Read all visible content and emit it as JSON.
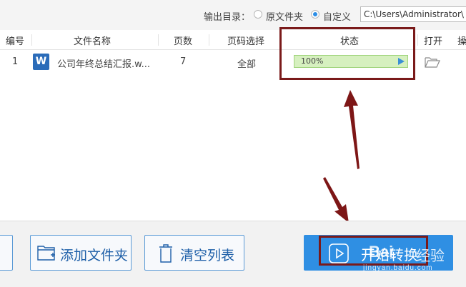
{
  "toolbar": {
    "output_label": "输出目录：",
    "radio_original": "原文件夹",
    "radio_custom": "自定义",
    "custom_selected": true,
    "path_value": "C:\\Users\\Administrator\\"
  },
  "table": {
    "headers": [
      "编号",
      "文件名称",
      "页数",
      "页码选择",
      "状态",
      "打开",
      "操"
    ],
    "rows": [
      {
        "index": "1",
        "file_icon": "word-icon",
        "file_icon_letter": "W",
        "file_name": "公司年终总结汇报.w...",
        "pages": "7",
        "page_selection": "全部",
        "status_text": "100%",
        "progress": 1.0,
        "open_icon": "folder-open-icon"
      }
    ]
  },
  "buttons": {
    "add_folder": "添加文件夹",
    "clear_list": "清空列表",
    "start": "开始转换",
    "start_icon": "play-icon"
  },
  "watermark": {
    "brand": "Bai",
    "suffix": "经验",
    "url": "jingyan.baidu.com"
  },
  "colors": {
    "accent": "#2f8fe3",
    "highlight": "#7a1a1a",
    "progress": "#e3f5d2"
  }
}
